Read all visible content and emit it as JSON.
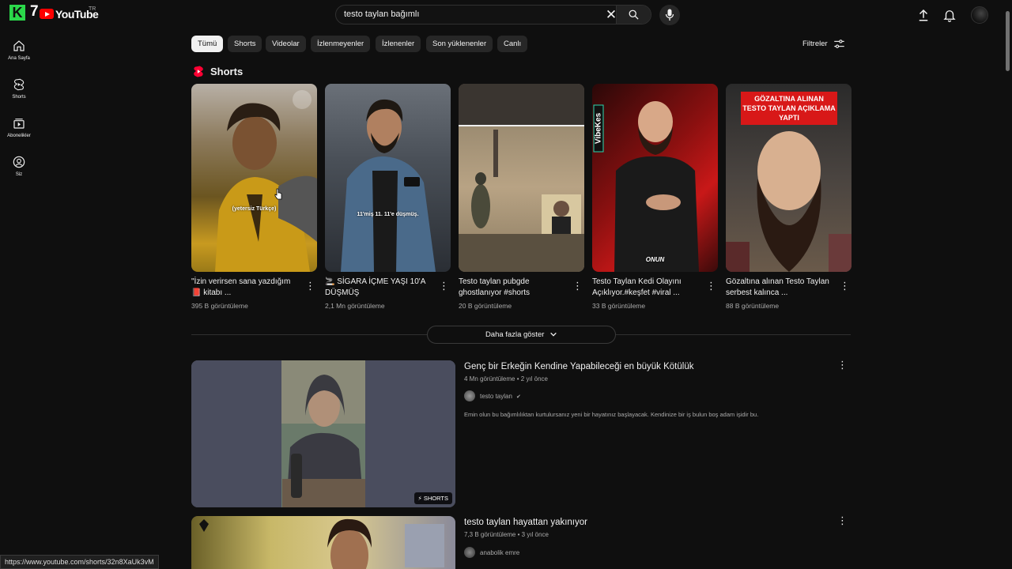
{
  "header": {
    "logo_k": "K",
    "logo_7": "7",
    "logo_text": "YouTube",
    "region": "TR",
    "search_value": "testo taylan bağımlı",
    "clear_glyph": "✕"
  },
  "sidebar": {
    "items": [
      {
        "label": "Ana Sayfa",
        "icon": "home-icon"
      },
      {
        "label": "Shorts",
        "icon": "shorts-icon"
      },
      {
        "label": "Abonelikler",
        "icon": "subscriptions-icon"
      },
      {
        "label": "Siz",
        "icon": "you-icon"
      }
    ]
  },
  "chips": {
    "items": [
      "Tümü",
      "Shorts",
      "Videolar",
      "İzlenmeyenler",
      "İzlenenler",
      "Son yüklenenler",
      "Canlı"
    ],
    "filters_label": "Filtreler"
  },
  "shorts": {
    "section_title": "Shorts",
    "items": [
      {
        "title": "\"İzin verirsen sana yazdığım 📕 kitabı ...",
        "views": "395 B görüntüleme",
        "caption": "(yetersiz Türkçe)"
      },
      {
        "title": "🚬 SİGARA İÇME YAŞI 10'A DÜŞMÜŞ",
        "views": "2,1 Mn görüntüleme",
        "caption": "11'miş 11. 11'e düşmüş."
      },
      {
        "title": "Testo taylan pubgde ghostlanıyor #shorts",
        "views": "20 B görüntüleme",
        "caption": ""
      },
      {
        "title": "Testo Taylan Kedi Olayını Açıklıyor.#keşfet #viral ...",
        "views": "33 B görüntüleme",
        "caption": "ONUN",
        "side_text": "VibeKes"
      },
      {
        "title": "Gözaltına alınan Testo Taylan serbest kalınca ...",
        "views": "88 B görüntüleme",
        "caption": "GÖZALTINA ALINAN TESTO TAYLAN AÇIKLAMA YAPTI"
      }
    ],
    "more_label": "Daha fazla göster"
  },
  "videos": [
    {
      "title": "Genç bir Erkeğin Kendine Yapabileceği en büyük Kötülük",
      "views": "4 Mn görüntüleme",
      "age": "2 yıl önce",
      "channel": "testo taylan",
      "verified": "✔",
      "description": "Emin olun bu bağımlılıktan kurtulursanız yeni bir hayatınız başlayacak. Kendinize bir iş bulun boş adam işidir bu.",
      "badge": "SHORTS"
    },
    {
      "title": "testo taylan hayattan yakınıyor",
      "views": "7,3 B görüntüleme",
      "age": "3 yıl önce",
      "channel": "anabolik emre"
    }
  ],
  "meta_separator": "•",
  "status_bar": {
    "url": "https://www.youtube.com/shorts/32n8XaUk3vM"
  }
}
